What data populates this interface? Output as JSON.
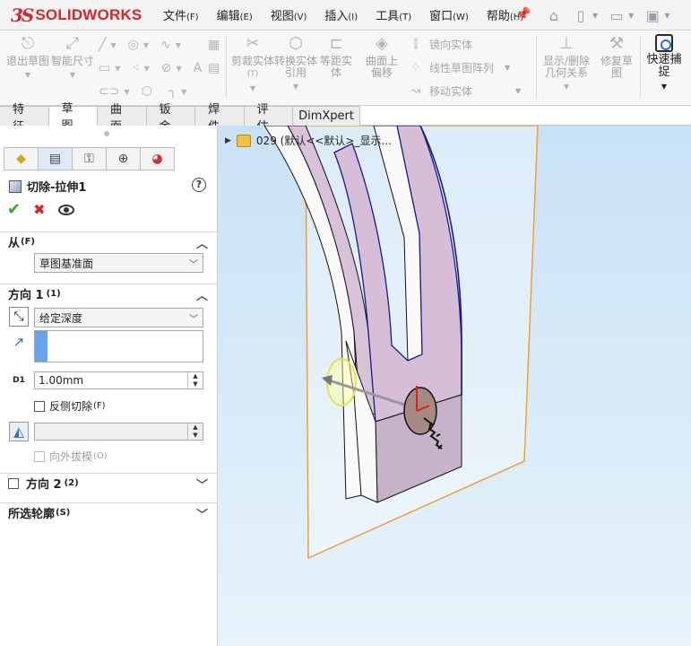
{
  "brand": {
    "logo_ds": "3S",
    "logo_text": "SOLIDWORKS"
  },
  "menu": [
    {
      "label": "文件",
      "key": "(F)"
    },
    {
      "label": "编辑",
      "key": "(E)"
    },
    {
      "label": "视图",
      "key": "(V)"
    },
    {
      "label": "插入",
      "key": "(I)"
    },
    {
      "label": "工具",
      "key": "(T)"
    },
    {
      "label": "窗口",
      "key": "(W)"
    },
    {
      "label": "帮助",
      "key": "(H)"
    }
  ],
  "command": {
    "exit_sketch": "退出草图",
    "smart_dim": "智能尺寸",
    "trim": "剪裁实体",
    "trim_sub": "(T)",
    "convert": "转换实体引用",
    "offset": "等距实体",
    "surface_offset": "曲面上偏移",
    "mirror": "镜向实体",
    "linear_pattern": "线性草图阵列",
    "move": "移动实体",
    "show_delete": "显示/删除几何关系",
    "repair": "修复草图",
    "quick_snap": "快速捕捉"
  },
  "tabs": [
    "特征",
    "草图",
    "曲面",
    "钣金",
    "焊件",
    "评估",
    "DimXpert"
  ],
  "active_tab": "草图",
  "property_manager": {
    "title": "切除-拉伸1",
    "help": "?",
    "from_label": "从",
    "from_key": "(F)",
    "from_value": "草图基准面",
    "dir1_label": "方向 1",
    "dir1_key": "(1)",
    "end_condition": "给定深度",
    "depth": "1.00mm",
    "flip_side_label": "反侧切除",
    "flip_side_key": "(F)",
    "draft_outward_label": "向外拔模",
    "draft_outward_key": "(O)",
    "dir2_label": "方向 2",
    "dir2_key": "(2)",
    "contours_label": "所选轮廓",
    "contours_key": "(S)",
    "depth_icon_label": "D1"
  },
  "feature_tree": {
    "label": "029  (默认<<默认>_显示..."
  }
}
